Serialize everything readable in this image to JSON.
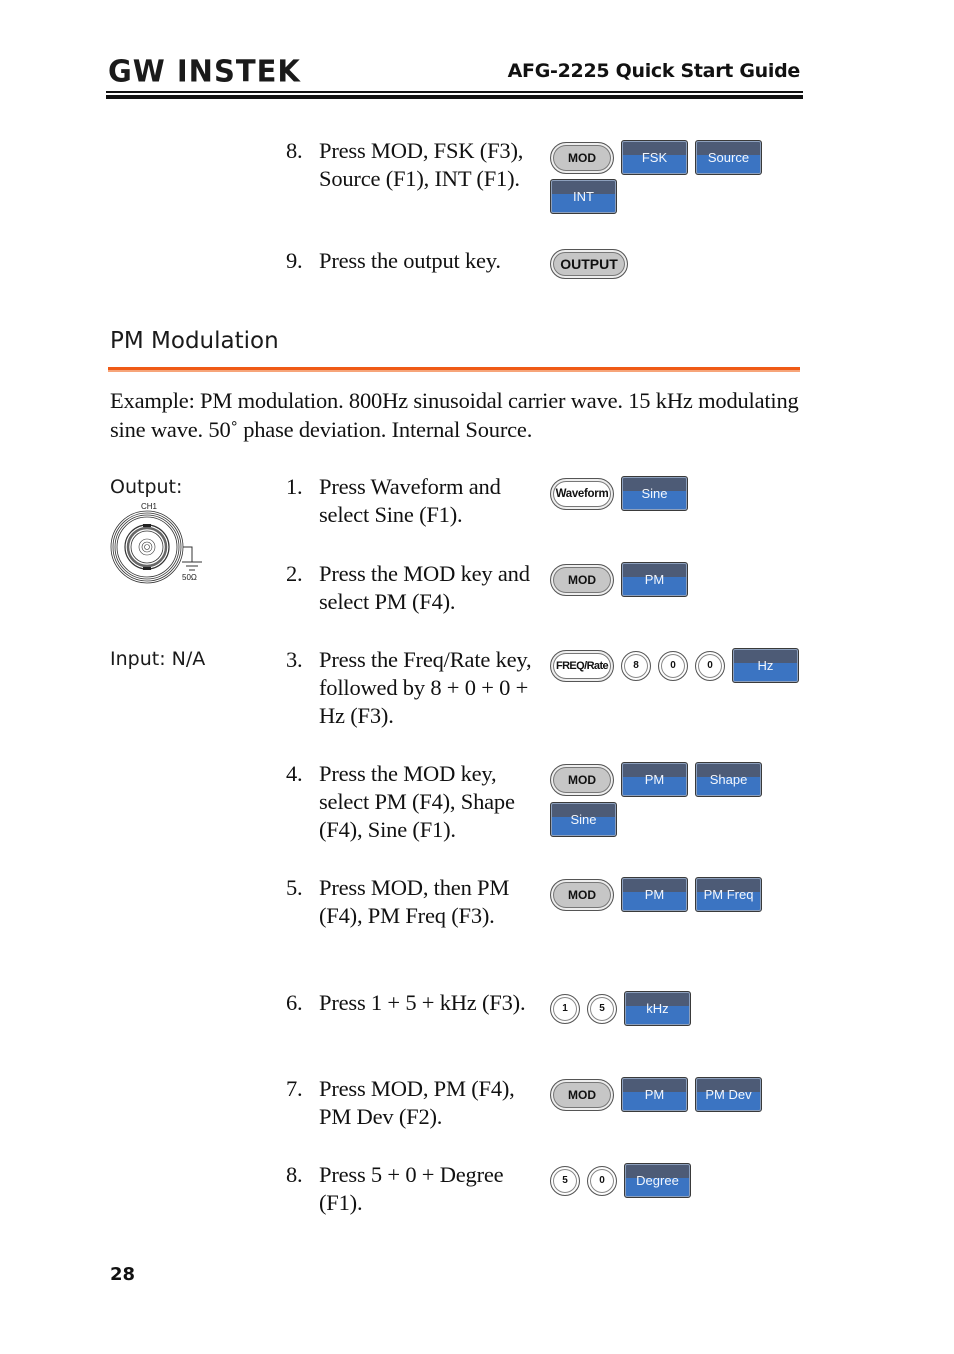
{
  "header": {
    "brand": "GW INSTEK",
    "guide_title": "AFG-2225 Quick Start Guide"
  },
  "prev_steps": [
    {
      "num": "8.",
      "text": "Press MOD, FSK (F3), Source (F1), INT (F1).",
      "keys": [
        "MOD",
        "FSK",
        "Source",
        "INT"
      ]
    },
    {
      "num": "9.",
      "text": "Press the output key.",
      "keys": [
        "OUTPUT"
      ]
    }
  ],
  "section": {
    "title": "PM Modulation",
    "intro": "Example: PM modulation. 800Hz sinusoidal carrier wave. 15 kHz modulating sine wave. 50˚ phase deviation. Internal Source.",
    "output_label": "Output:",
    "connector": {
      "channel": "CH1",
      "impedance": "50Ω"
    },
    "input_label": "Input: N/A"
  },
  "steps": [
    {
      "num": "1.",
      "text": "Press Waveform and select Sine (F1).",
      "keys": [
        "Waveform",
        "Sine"
      ]
    },
    {
      "num": "2.",
      "text": "Press the MOD key and select PM (F4).",
      "keys": [
        "MOD",
        "PM"
      ]
    },
    {
      "num": "3.",
      "text": "Press the Freq/Rate key, followed by 8 + 0 + 0 + Hz (F3).",
      "keys": [
        "FREQ/Rate",
        "8",
        "0",
        "0",
        "Hz"
      ]
    },
    {
      "num": "4.",
      "text": "Press the MOD key, select PM (F4), Shape (F4), Sine (F1).",
      "keys": [
        "MOD",
        "PM",
        "Shape",
        "Sine"
      ]
    },
    {
      "num": "5.",
      "text": "Press MOD, then PM (F4), PM Freq (F3).",
      "keys": [
        "MOD",
        "PM",
        "PM Freq"
      ]
    },
    {
      "num": "6.",
      "text": "Press 1 + 5 + kHz (F3).",
      "keys": [
        "1",
        "5",
        "kHz"
      ]
    },
    {
      "num": "7.",
      "text": "Press MOD, PM (F4), PM Dev (F2).",
      "keys": [
        "MOD",
        "PM",
        "PM Dev"
      ]
    },
    {
      "num": "8.",
      "text": "Press 5 + 0 + Degree (F1).",
      "keys": [
        "5",
        "0",
        "Degree"
      ]
    }
  ],
  "footer": {
    "page_number": "28"
  },
  "colors": {
    "section_rule": "#ef5a16",
    "softkey_top": "#4d5b76",
    "softkey_bottom": "#3b74c2"
  }
}
